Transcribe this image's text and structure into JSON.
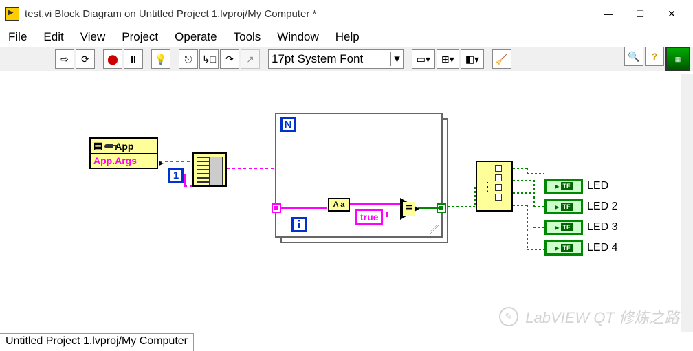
{
  "window": {
    "title": "test.vi Block Diagram on Untitled Project 1.lvproj/My Computer *"
  },
  "menu": {
    "file": "File",
    "edit": "Edit",
    "view": "View",
    "project": "Project",
    "operate": "Operate",
    "tools": "Tools",
    "window": "Window",
    "help": "Help"
  },
  "toolbar": {
    "font": "17pt System Font"
  },
  "diagram": {
    "prop_node": {
      "header": "App",
      "property": "App.Args"
    },
    "const_index": "1",
    "forloop": {
      "n": "N",
      "i": "i"
    },
    "aa_label": "A a",
    "true_const": "true",
    "eq_label": "=",
    "leds": [
      {
        "label": "LED"
      },
      {
        "label": "LED 2"
      },
      {
        "label": "LED 3"
      },
      {
        "label": "LED 4"
      }
    ],
    "tf_text": "TF"
  },
  "statusbar": "Untitled Project 1.lvproj/My Computer",
  "watermark": "LabVIEW QT 修炼之路"
}
